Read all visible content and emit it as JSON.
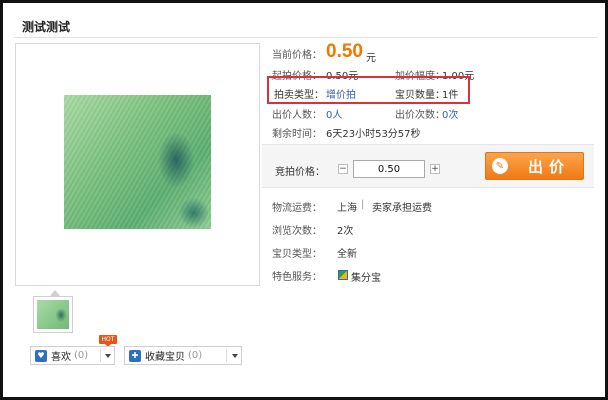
{
  "title": "测试测试",
  "info": {
    "current_price_label": "当前价格：",
    "current_price": "0.50",
    "currency": "元",
    "start_price_label": "起拍价格：",
    "start_price": "0.50元",
    "increment_label": "加价幅度：",
    "increment": "1.00元",
    "auction_type_label": "拍卖类型：",
    "auction_type": "增价拍",
    "quantity_label": "宝贝数量：",
    "quantity": "1件",
    "bidders_label": "出价人数：",
    "bidders": "0人",
    "bid_count_label": "出价次数：",
    "bid_count": "0次",
    "time_left_label": "剩余时间：",
    "time_left": "6天23小时53分57秒"
  },
  "bid": {
    "label": "竞拍价格：",
    "minus": "−",
    "plus": "+",
    "value": "0.50",
    "button_label": "出价"
  },
  "details": {
    "shipping_label": "物流运费：",
    "shipping_location": "上海",
    "shipping_sep": "|",
    "shipping_note": "卖家承担运费",
    "views_label": "浏览次数：",
    "views": "2次",
    "condition_label": "宝贝类型：",
    "condition": "全新",
    "services_label": "特色服务：",
    "service_name": "集分宝"
  },
  "actions": {
    "hot_badge": "HOT",
    "like_label": "喜欢",
    "like_count": "(0)",
    "collect_label": "收藏宝贝",
    "collect_count": "(0)"
  },
  "colors": {
    "price": "#f07800",
    "link": "#2f61b5",
    "highlight": "#d8323a",
    "bid_button": "#f07a16"
  }
}
